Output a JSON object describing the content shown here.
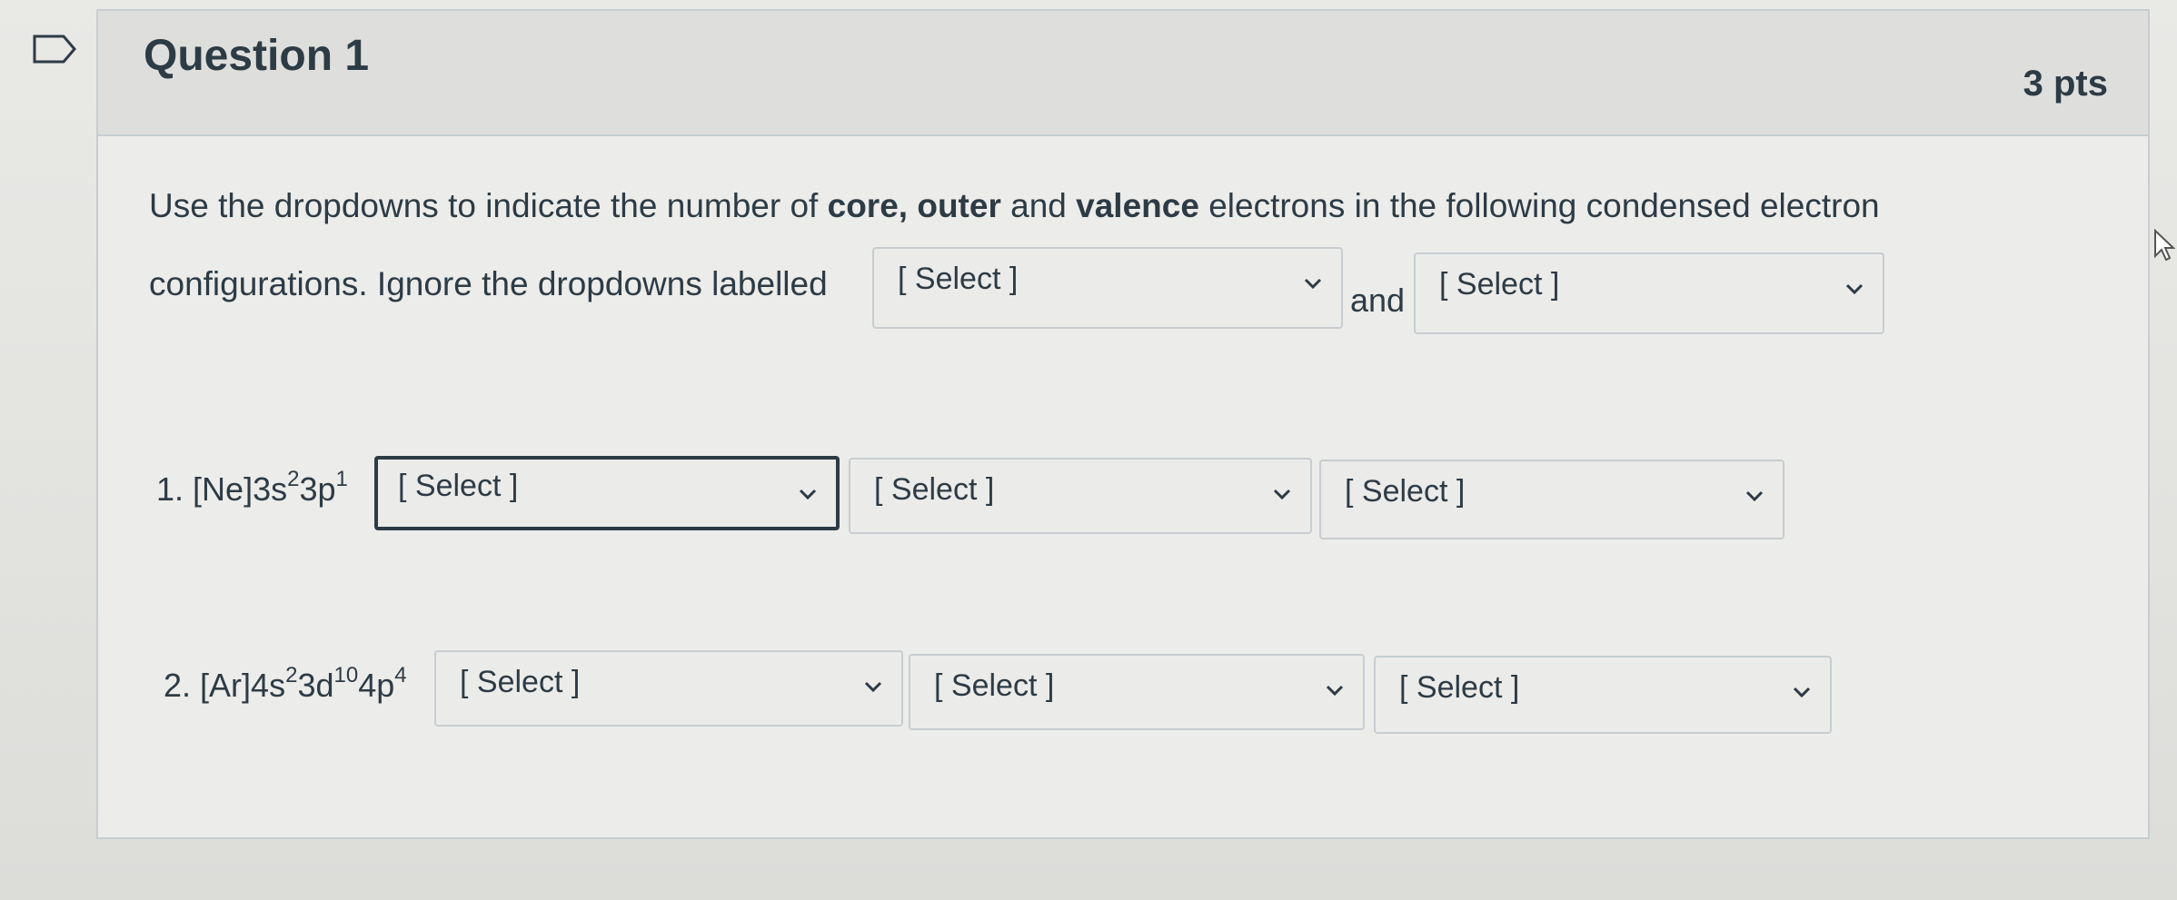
{
  "question": {
    "title": "Question 1",
    "points": "3 pts",
    "flag_icon": "flag-outline-icon"
  },
  "instructions": {
    "line1_part1": "Use the dropdowns to indicate the number of ",
    "line1_bold": "core, outer",
    "line1_part2": " and ",
    "line1_bold2": "valence",
    "line1_part3": " electrons in the following condensed electron",
    "line2_text": "configurations.  Ignore the dropdowns labelled",
    "and_text": "and",
    "dropdown_a": "[ Select ]",
    "dropdown_b": "[ Select ]"
  },
  "items": [
    {
      "number": "1.",
      "config_base": "[Ne]3s",
      "sup1": "2",
      "mid1": "3p",
      "sup2": "1",
      "dropdowns": [
        "[ Select ]",
        "[ Select ]",
        "[ Select ]"
      ]
    },
    {
      "number": "2.",
      "config_base": "[Ar]4s",
      "sup1": "2",
      "mid1": "3d",
      "sup2": "10",
      "mid2": "4p",
      "sup3": "4",
      "dropdowns": [
        "[ Select ]",
        "[ Select ]",
        "[ Select ]"
      ]
    }
  ],
  "icons": {
    "chevron": "chevron-down-icon",
    "cursor": "mouse-pointer-icon"
  },
  "colors": {
    "text": "#2d3b45",
    "border": "#c7cdd1",
    "header_bg": "#dedfdd"
  }
}
